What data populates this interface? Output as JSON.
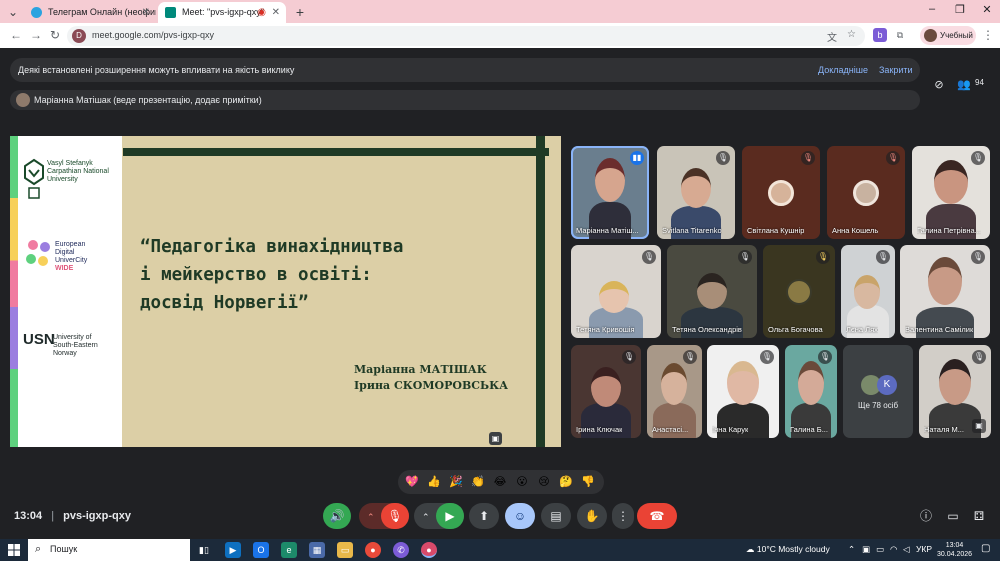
{
  "browser": {
    "tabs": [
      {
        "title": "Телеграм Онлайн (неофициа...",
        "active": false
      },
      {
        "title": "Meet: \"pvs-igxp-qxy\"",
        "active": true
      }
    ],
    "new_tab": "+",
    "url": "meet.google.com/pvs-igxp-qxy",
    "site_badge": "D",
    "profile_label": "Учебный",
    "window_controls": {
      "minimize": "–",
      "maximize": "❐",
      "close": "✕"
    }
  },
  "meet": {
    "banner": {
      "message": "Деякі встановлені розширення можуть впливати на якість виклику",
      "details_link": "Докладніше",
      "close_link": "Закрити"
    },
    "presenter_banner": "Маріанна Матішак (веде презентацію, додає примітки)",
    "participant_count": "94",
    "slide": {
      "logos": {
        "vnu": [
          "Vasyl Stefanyk",
          "Carpathian National",
          "University"
        ],
        "edu": [
          "European",
          "Digital",
          "UniverCity",
          "WIDE"
        ],
        "usn_mark": "USN",
        "usn": [
          "University of",
          "South-Eastern Norway"
        ]
      },
      "title_lines": [
        "“Педагогіка винахідництва",
        "і мейкерство в освіті:",
        "досвід Норвегії”"
      ],
      "authors": [
        "Маріанна МАТІШАК",
        "Ірина СКОМОРОВСЬКА"
      ]
    },
    "participants": [
      {
        "name": "Маріанна Матіш...",
        "speaking": true
      },
      {
        "name": "Svitlana Titarenko"
      },
      {
        "name": "Світлана Кушнір"
      },
      {
        "name": "Анна Кошель"
      },
      {
        "name": "Галина Петрівна..."
      },
      {
        "name": "Тетяна Кривошія"
      },
      {
        "name": "Тетяна Олександрів..."
      },
      {
        "name": "Ольга Богачова"
      },
      {
        "name": "Лєна Лях"
      },
      {
        "name": "Валентина Самілик"
      },
      {
        "name": "Ірина Ключак"
      },
      {
        "name": "Анастасі..."
      },
      {
        "name": "Інна Карук"
      },
      {
        "name": "Галина Б..."
      },
      {
        "name": "Наталя М..."
      }
    ],
    "more_others": "Ще 78 осіб",
    "more_avatar_letter": "K",
    "reactions": [
      "💖",
      "👍",
      "🎉",
      "👏",
      "😂",
      "😮",
      "😢",
      "🤔",
      "👎"
    ],
    "clock": "13:04",
    "meeting_code": "pvs-igxp-qxy"
  },
  "taskbar": {
    "search_placeholder": "Пошук",
    "weather": "10°C  Mostly cloudy",
    "language": "УКР",
    "time": "13:04",
    "date": "30.04.2026"
  },
  "colors": {
    "meet_bg": "#202124",
    "slide_bg": "#dccfa6",
    "slide_dark": "#1f3a25",
    "end_call": "#ea4335",
    "speaking": "#8ab4f8"
  }
}
